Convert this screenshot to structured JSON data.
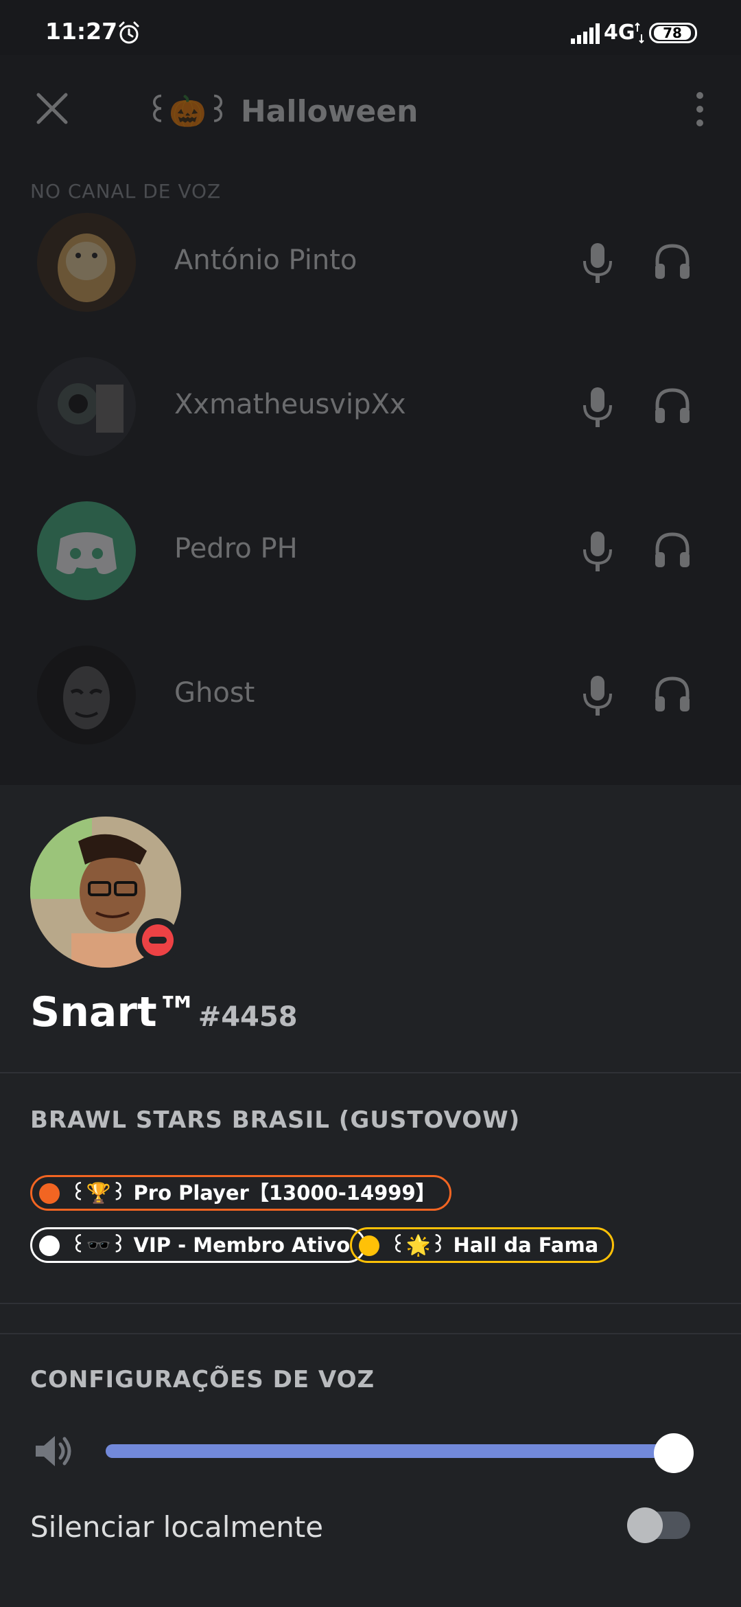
{
  "status_bar": {
    "time": "11:27",
    "network": "4G",
    "battery": "78",
    "alarm_icon": "alarm-icon",
    "signal_icon": "signal-icon"
  },
  "channel": {
    "title": "꒰🎃꒱ Halloween",
    "section_label": "NO CANAL DE VOZ",
    "members": [
      {
        "name": "António Pinto",
        "avatar": "doge-avatar"
      },
      {
        "name": "XxmatheusvipXx",
        "avatar": "dark-avatar"
      },
      {
        "name": "Pedro PH",
        "avatar": "discord-default-avatar"
      },
      {
        "name": "Ghost",
        "avatar": "mask-avatar"
      }
    ]
  },
  "profile": {
    "username": "Snart™",
    "discriminator": "#4458",
    "status": "do-not-disturb"
  },
  "server": {
    "name": "BRAWL STARS BRASIL (GUSTOVOW)",
    "roles": [
      {
        "label": "꒰🏆꒱ Pro Player【13000-14999】",
        "color": "#f26522"
      },
      {
        "label": "꒰🕶️꒱ VIP - Membro Ativo",
        "color": "#ffffff"
      },
      {
        "label": "꒰🌟꒱ Hall da Fama",
        "color": "#ffc107"
      }
    ]
  },
  "voice_settings": {
    "label": "CONFIGURAÇÕES DE VOZ",
    "volume_fraction": 0.99,
    "mute_label": "Silenciar localmente",
    "mute_enabled": false,
    "accent_color": "#7289da"
  }
}
